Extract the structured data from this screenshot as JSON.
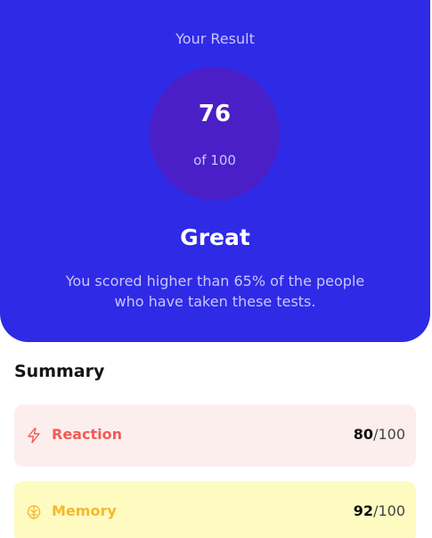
{
  "result": {
    "heading": "Your Result",
    "score": "76",
    "max_label": "of 100",
    "rating": "Great",
    "description": "You scored higher than 65% of the people who have taken these tests."
  },
  "summary": {
    "title": "Summary",
    "items": [
      {
        "label": "Reaction",
        "score": "80",
        "max": "/100",
        "icon": "lightning-icon",
        "color": "#f25c54",
        "background": "#fdeeee"
      },
      {
        "label": "Memory",
        "score": "92",
        "max": "/100",
        "icon": "brain-icon",
        "color": "#f5b82e",
        "background": "#fefbc1"
      }
    ]
  },
  "colors": {
    "primary": "#2f2ae6",
    "circle": "#4b1fc8",
    "muted_text": "#c8c6ff"
  }
}
